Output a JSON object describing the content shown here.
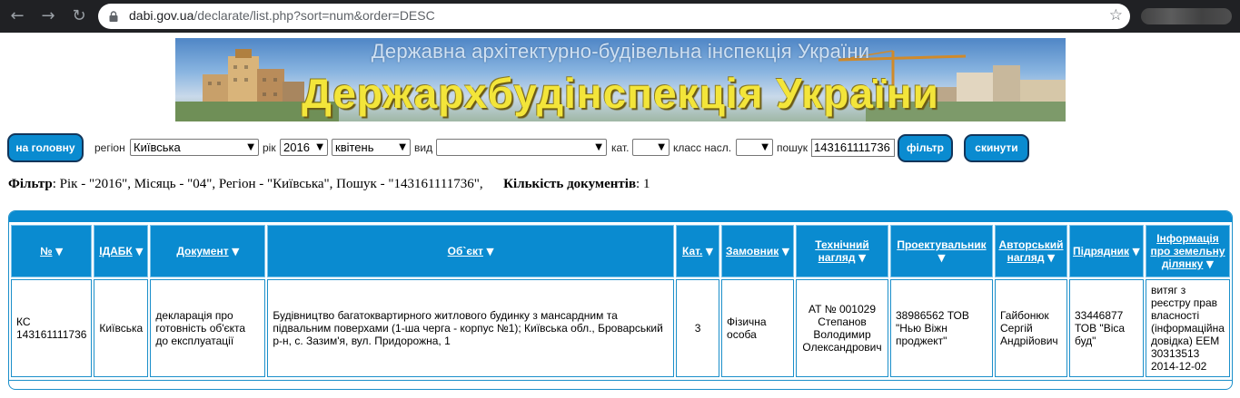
{
  "browser": {
    "url_domain": "dabi.gov.ua",
    "url_path": "/declarate/list.php?sort=num&order=DESC"
  },
  "banner": {
    "top_text": "Державна архітектурно-будівельна інспекція України",
    "main_text": "Держархбудінспекція України"
  },
  "filters": {
    "home_button": "на головну",
    "region_label": "регіон",
    "region_value": "Київська",
    "year_label": "рік",
    "year_value": "2016",
    "month_value": "квітень",
    "kind_label": "вид",
    "kind_value": "",
    "cat_label": "кат.",
    "cat_value": "",
    "class_label": "класс насл.",
    "class_value": "",
    "search_label": "пошук",
    "search_value": "143161111736",
    "filter_button": "фільтр",
    "reset_button": "скинути"
  },
  "summary": {
    "filter_label": "Фільтр",
    "filter_text": ": Рік - \"2016\", Місяць - \"04\", Регіон - \"Київська\", Пошук - \"143161111736\",",
    "count_label": "Кількість документів",
    "count_value": ": 1"
  },
  "table": {
    "headers": [
      "№",
      "ІДАБК",
      "Документ",
      "Об`єкт",
      "Кат.",
      "Замовник",
      "Технічний нагляд",
      "Проектувальник",
      "Авторський нагляд",
      "Підрядник",
      "Інформація про земельну ділянку"
    ],
    "rows": [
      {
        "num": "КС 143161111736",
        "idabk": "Київська",
        "document": "декларація про готовність об'єкта до експлуатації",
        "object": "Будівництво багатоквартирного житлового будинку з мансардним та підвальним поверхами (1-ша черга - корпус №1); Київська обл., Броварський р-н, с. Зазим'я, вул. Придорожна, 1",
        "cat": "3",
        "customer": "Фізична особа",
        "tech_supervision": "АТ № 001029 Степанов Володимир Олександрович",
        "designer": "38986562 ТОВ \"Нью Віжн проджект\"",
        "author_supervision": "Гайбонюк Сергій Андрійович",
        "contractor": "33446877 ТОВ \"Віса буд\"",
        "land_info": "витяг з реєстру прав власності (інформаційна довідка) ЕЕМ 30313513 2014-12-02"
      }
    ]
  },
  "colors": {
    "accent": "#0a8bd0",
    "button_border": "#12355a",
    "banner_text": "#f3e53a"
  },
  "icons": {
    "sort": "sort-desc-triangle-icon",
    "dropdown": "chevron-down-icon"
  }
}
